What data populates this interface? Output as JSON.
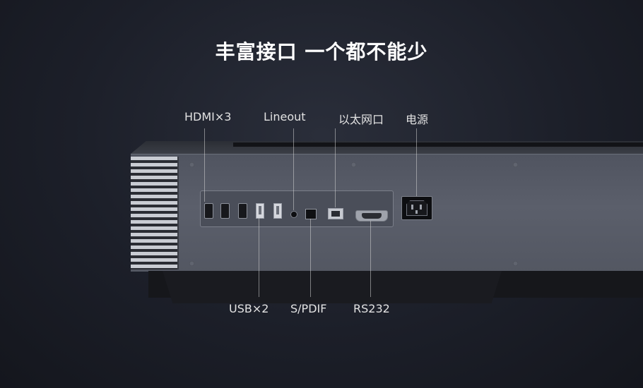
{
  "headline": "丰富接口 一个都不能少",
  "labels": {
    "hdmi": "HDMI×3",
    "lineout": "Lineout",
    "ethernet": "以太网口",
    "power": "电源",
    "usb": "USB×2",
    "spdif": "S/PDIF",
    "rs232": "RS232"
  }
}
